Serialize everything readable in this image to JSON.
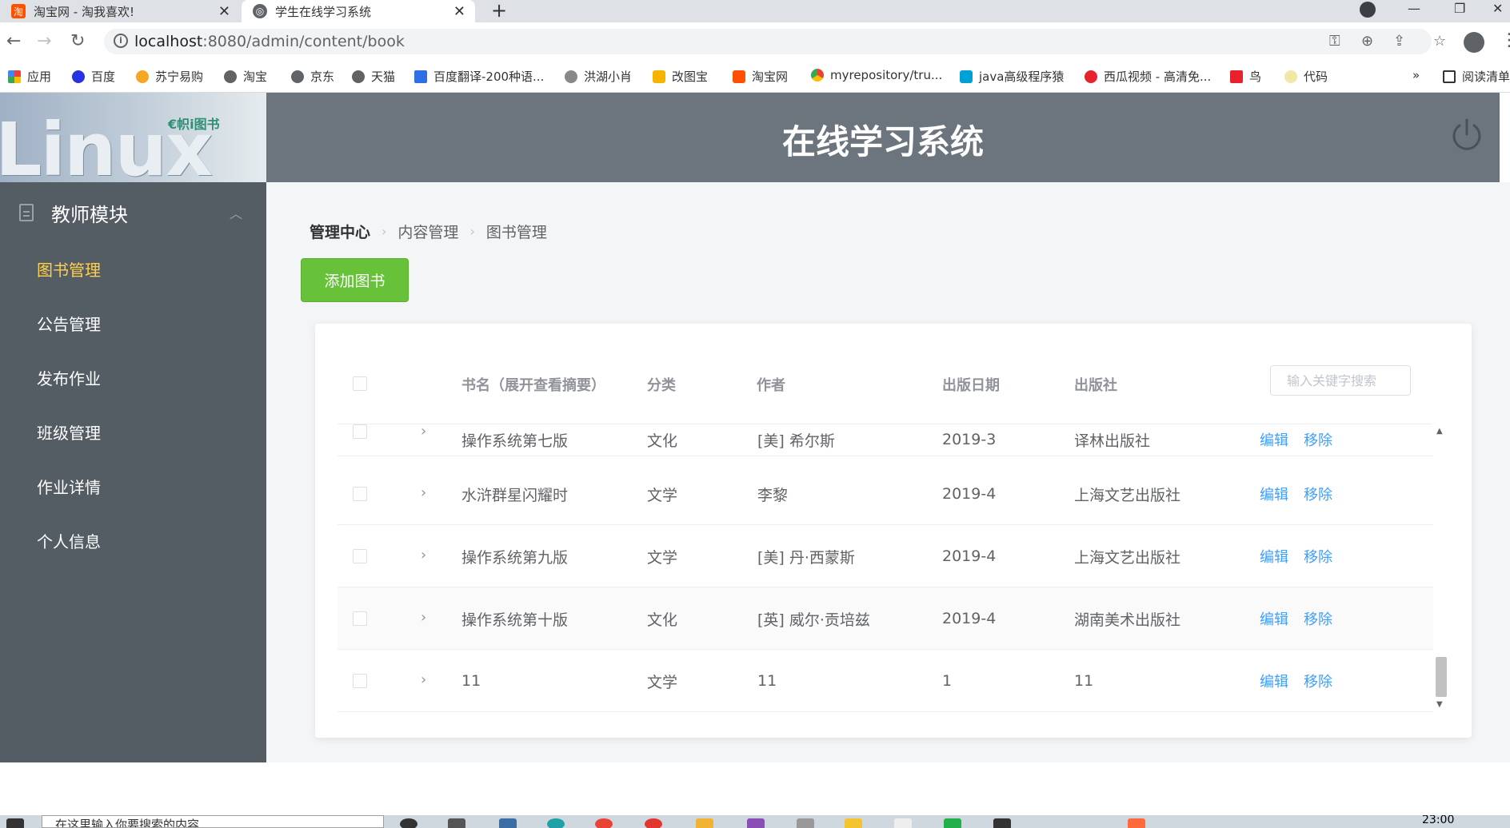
{
  "browser": {
    "tabs": [
      {
        "title": "淘宝网 - 淘我喜欢!",
        "active": false
      },
      {
        "title": "学生在线学习系统",
        "active": true
      }
    ],
    "url_host": "localhost",
    "url_path": ":8080/admin/content/book",
    "bookmarks": [
      "应用",
      "百度",
      "苏宁易购",
      "淘宝",
      "京东",
      "天猫",
      "百度翻译-200种语...",
      "洪湖小肖",
      "改图宝",
      "淘宝网",
      "myrepository/tru...",
      "java高级程序猿",
      "西瓜视频 - 高清免...",
      "鸟",
      "代码",
      "阅读清单"
    ]
  },
  "app": {
    "logo_text": "Linux",
    "logo_badge": "€帜i图书",
    "title": "在线学习系统"
  },
  "sidebar": {
    "module": "教师模块",
    "items": [
      {
        "label": "图书管理",
        "active": true
      },
      {
        "label": "公告管理",
        "active": false
      },
      {
        "label": "发布作业",
        "active": false
      },
      {
        "label": "班级管理",
        "active": false
      },
      {
        "label": "作业详情",
        "active": false
      },
      {
        "label": "个人信息",
        "active": false
      }
    ]
  },
  "breadcrumb": [
    "管理中心",
    "内容管理",
    "图书管理"
  ],
  "add_button": "添加图书",
  "table": {
    "columns": {
      "title": "书名（展开查看摘要）",
      "category": "分类",
      "author": "作者",
      "date": "出版日期",
      "publisher": "出版社"
    },
    "search_placeholder": "输入关键字搜索",
    "rows": [
      {
        "title": "操作系统第七版",
        "category": "文化",
        "author": "[美] 希尔斯",
        "date": "2019-3",
        "publisher": "译林出版社"
      },
      {
        "title": "水浒群星闪耀时",
        "category": "文学",
        "author": "李黎",
        "date": "2019-4",
        "publisher": "上海文艺出版社"
      },
      {
        "title": "操作系统第九版",
        "category": "文学",
        "author": "[美] 丹·西蒙斯",
        "date": "2019-4",
        "publisher": "上海文艺出版社"
      },
      {
        "title": "操作系统第十版",
        "category": "文化",
        "author": "[英] 威尔·贡培兹",
        "date": "2019-4",
        "publisher": "湖南美术出版社"
      },
      {
        "title": "11",
        "category": "文学",
        "author": "11",
        "date": "1",
        "publisher": "11"
      }
    ],
    "actions": {
      "edit": "编辑",
      "remove": "移除"
    }
  },
  "taskbar": {
    "search_text": "在这里输入你要搜索的内容",
    "clock": "23:00"
  },
  "colors": {
    "header_bg": "#6c747d",
    "sidebar_bg": "#545c64",
    "active_menu": "#ffd04b",
    "primary_link": "#409eff",
    "success_button": "#67c23a"
  }
}
